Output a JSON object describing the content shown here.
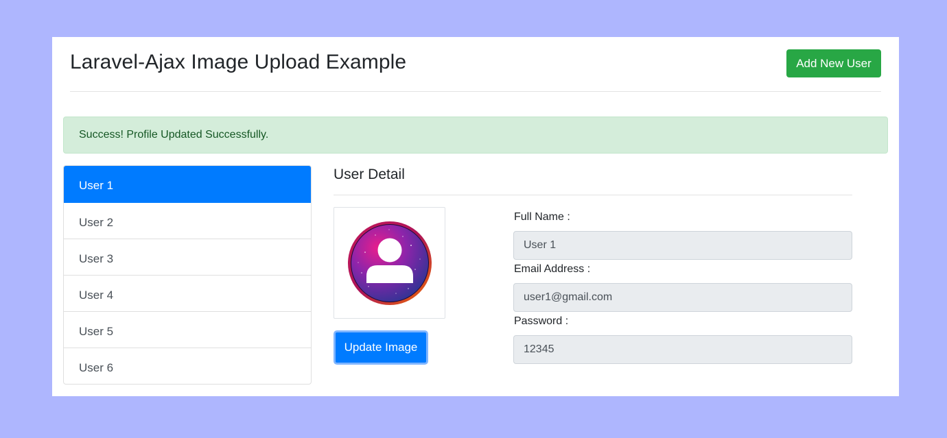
{
  "header": {
    "title": "Laravel-Ajax Image Upload Example",
    "add_button_label": "Add New User"
  },
  "alert": {
    "message": "Success! Profile Updated Successfully."
  },
  "user_list": {
    "items": [
      {
        "label": "User 1",
        "active": true
      },
      {
        "label": "User 2",
        "active": false
      },
      {
        "label": "User 3",
        "active": false
      },
      {
        "label": "User 4",
        "active": false
      },
      {
        "label": "User 5",
        "active": false
      },
      {
        "label": "User 6",
        "active": false
      }
    ]
  },
  "detail": {
    "title": "User Detail",
    "avatar_icon": "user-avatar-icon",
    "update_button_label": "Update Image",
    "fields": {
      "full_name": {
        "label": "Full Name :",
        "value": "User 1"
      },
      "email": {
        "label": "Email Address :",
        "value": "user1@gmail.com"
      },
      "password": {
        "label": "Password :",
        "value": "12345"
      }
    }
  },
  "colors": {
    "background": "#aeb6fe",
    "primary": "#007bff",
    "success": "#28a745",
    "alert_bg": "#d4edda",
    "alert_text": "#155724",
    "input_bg": "#e9ecef"
  }
}
